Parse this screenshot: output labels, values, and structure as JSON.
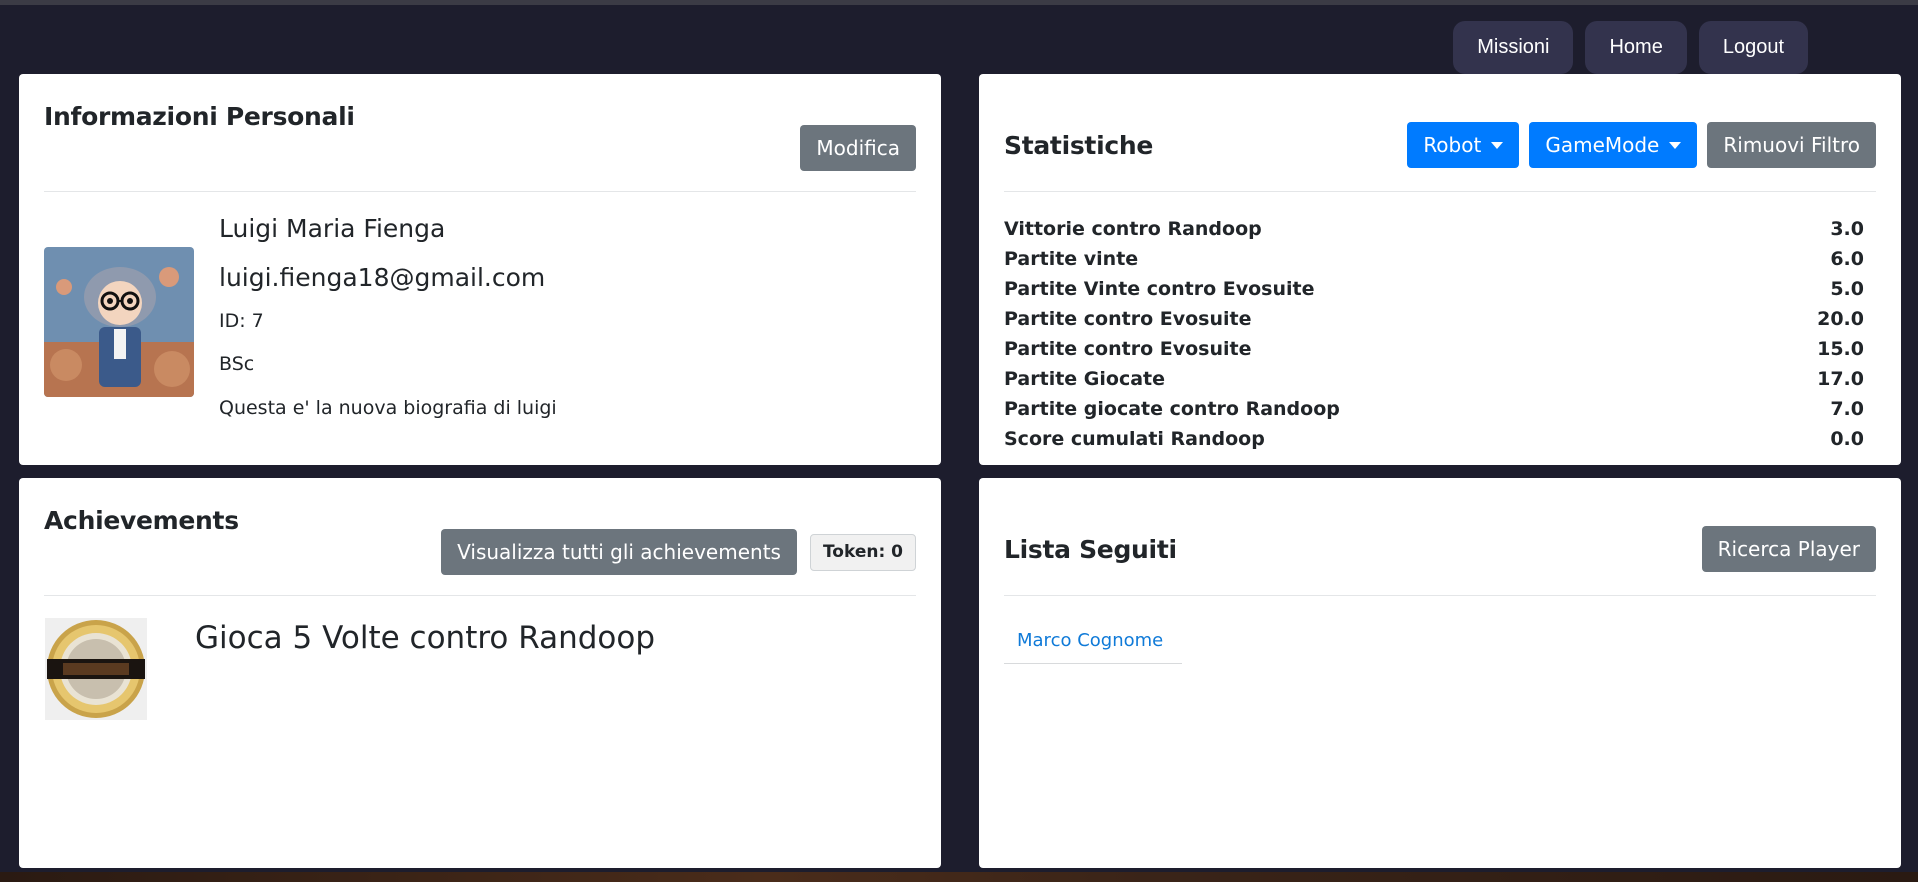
{
  "nav": {
    "missions": "Missioni",
    "home": "Home",
    "logout": "Logout"
  },
  "personal_info": {
    "title": "Informazioni Personali",
    "edit_button": "Modifica",
    "name": "Luigi Maria Fienga",
    "email": "luigi.fienga18@gmail.com",
    "id": "ID: 7",
    "degree": "BSc",
    "bio": "Questa e' la nuova biografia di luigi"
  },
  "stats": {
    "title": "Statistiche",
    "filter_robot": "Robot",
    "filter_gamemode": "GameMode",
    "remove_filter": "Rimuovi Filtro",
    "rows": [
      {
        "label": "Vittorie contro Randoop",
        "value": "3.0"
      },
      {
        "label": "Partite vinte",
        "value": "6.0"
      },
      {
        "label": "Partite Vinte contro Evosuite",
        "value": "5.0"
      },
      {
        "label": "Partite contro Evosuite",
        "value": "20.0"
      },
      {
        "label": "Partite contro Evosuite",
        "value": "15.0"
      },
      {
        "label": "Partite Giocate",
        "value": "17.0"
      },
      {
        "label": "Partite giocate contro Randoop",
        "value": "7.0"
      },
      {
        "label": "Score cumulati Randoop",
        "value": "0.0"
      }
    ]
  },
  "achievements": {
    "title": "Achievements",
    "view_all_button": "Visualizza tutti gli achievements",
    "token_badge": "Token: 0",
    "items": [
      {
        "title": "Gioca 5 Volte contro Randoop"
      }
    ]
  },
  "following": {
    "title": "Lista Seguiti",
    "search_button": "Ricerca Player",
    "items": [
      {
        "name": "Marco Cognome"
      }
    ]
  }
}
